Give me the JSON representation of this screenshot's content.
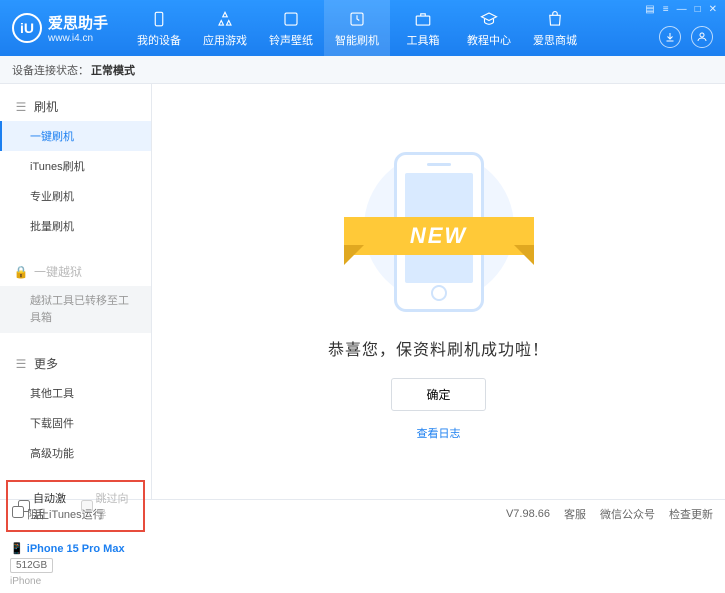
{
  "header": {
    "logo_letter": "iU",
    "app_title": "爱思助手",
    "app_url": "www.i4.cn",
    "nav": [
      {
        "label": "我的设备"
      },
      {
        "label": "应用游戏"
      },
      {
        "label": "铃声壁纸"
      },
      {
        "label": "智能刷机"
      },
      {
        "label": "工具箱"
      },
      {
        "label": "教程中心"
      },
      {
        "label": "爱思商城"
      }
    ]
  },
  "status": {
    "prefix": "设备连接状态：",
    "mode": "正常模式"
  },
  "sidebar": {
    "flash_head": "刷机",
    "flash_items": [
      "一键刷机",
      "iTunes刷机",
      "专业刷机",
      "批量刷机"
    ],
    "jailbreak_head": "一键越狱",
    "jailbreak_note": "越狱工具已转移至工具箱",
    "more_head": "更多",
    "more_items": [
      "其他工具",
      "下载固件",
      "高级功能"
    ],
    "checkbox1": "自动激活",
    "checkbox2": "跳过向导",
    "device_name": "iPhone 15 Pro Max",
    "device_storage": "512GB",
    "device_type": "iPhone"
  },
  "main": {
    "ribbon": "NEW",
    "success": "恭喜您，保资料刷机成功啦！",
    "confirm": "确定",
    "view_log": "查看日志"
  },
  "footer": {
    "block_itunes": "阻止iTunes运行",
    "version": "V7.98.66",
    "links": [
      "客服",
      "微信公众号",
      "检查更新"
    ]
  }
}
